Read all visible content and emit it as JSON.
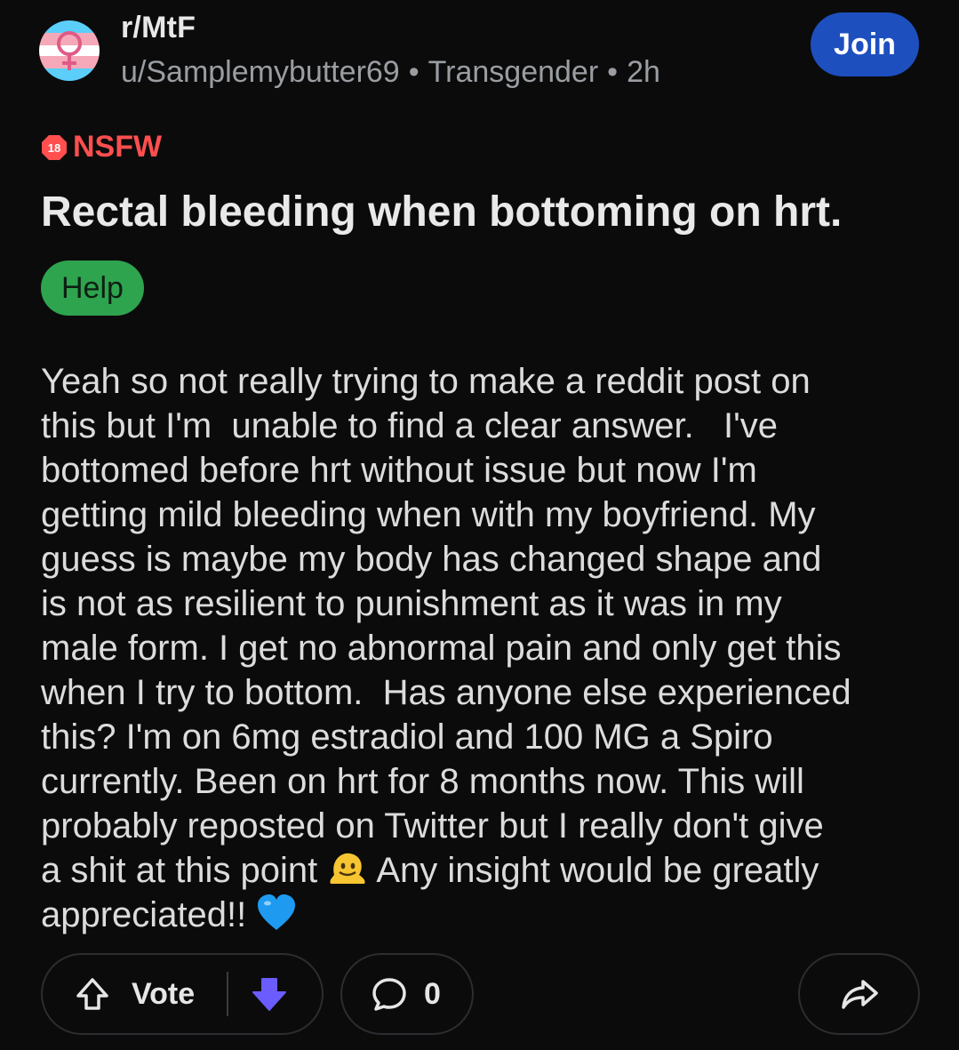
{
  "header": {
    "subreddit": "r/MtF",
    "username": "u/Samplemybutter69",
    "separator": "•",
    "flair_text": "Transgender",
    "time": "2h",
    "join_label": "Join"
  },
  "nsfw": {
    "badge_number": "18",
    "label": "NSFW"
  },
  "post": {
    "title": "Rectal bleeding when bottoming on hrt.",
    "flair": "Help",
    "body_part1": "Yeah so not really trying to make a reddit post on\nthis but I'm  unable to find a clear answer.   I've\nbottomed before hrt without issue but now I'm\ngetting mild bleeding when with my boyfriend. My\nguess is maybe my body has changed shape and\nis not as resilient to punishment as it was in my\nmale form. I get no abnormal pain and only get this\nwhen I try to bottom.  Has anyone else experienced\nthis? I'm on 6mg estradiol and 100 MG a Spiro\ncurrently. Been on hrt for 8 months now. This will\nprobably reposted on Twitter but I really don't give\na shit at this point ",
    "body_part2": " Any insight would be greatly\nappreciated!! "
  },
  "footer": {
    "vote_label": "Vote",
    "comment_count": "0"
  },
  "colors": {
    "background": "#0b0b0b",
    "join_button": "#1d4fbf",
    "nsfw_red": "#ff4f4f",
    "flair_green": "#2ea44f",
    "downvote_purple": "#6a5cff"
  },
  "icons": {
    "avatar": "trans-symbol-avatar",
    "nsfw": "18-plus-badge-icon",
    "emoji1": "melting-face-emoji",
    "emoji2": "blue-heart-emoji",
    "upvote": "upvote-arrow-icon",
    "downvote": "downvote-arrow-icon",
    "comment": "comment-bubble-icon",
    "share": "share-arrow-icon"
  }
}
